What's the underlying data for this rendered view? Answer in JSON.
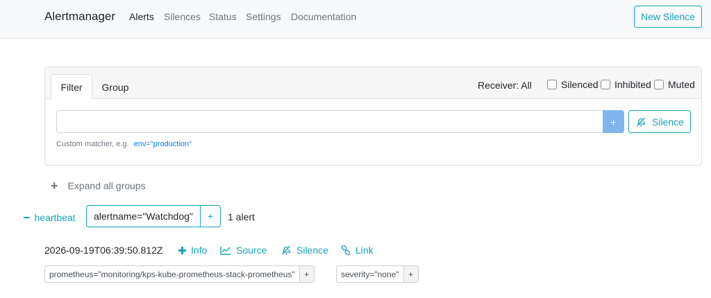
{
  "navbar": {
    "brand": "Alertmanager",
    "links": [
      "Alerts",
      "Silences",
      "Status",
      "Settings",
      "Documentation"
    ],
    "active_link": "Alerts",
    "new_silence": "New Silence"
  },
  "filter_card": {
    "tabs": [
      "Filter",
      "Group"
    ],
    "active_tab": "Filter",
    "receiver": "Receiver: All",
    "checkboxes": [
      {
        "label": "Silenced",
        "checked": false
      },
      {
        "label": "Inhibited",
        "checked": false
      },
      {
        "label": "Muted",
        "checked": false
      }
    ],
    "input_value": "",
    "add_label": "+",
    "silence_label": "Silence",
    "hint_prefix": "Custom matcher, e.g.",
    "hint_example": "env=\"production\""
  },
  "expand_all": {
    "icon": "+",
    "label": "Expand all groups"
  },
  "group": {
    "toggle_icon": "−",
    "name": "heartbeat",
    "label": "alertname=\"Watchdog\"",
    "label_plus": "+",
    "count": "1 alert"
  },
  "alert": {
    "timestamp": "2026-09-19T06:39:50.812Z",
    "actions": {
      "info": "Info",
      "source": "Source",
      "silence": "Silence",
      "link": "Link"
    },
    "labels": [
      {
        "text": "prometheus=\"monitoring/kps-kube-prometheus-stack-prometheus\"",
        "plus": "+"
      },
      {
        "text": "severity=\"none\"",
        "plus": "+"
      }
    ]
  },
  "colors": {
    "accent": "#17a2b8",
    "link_blue": "#007bff",
    "add_button": "#80b5f0",
    "navbar_bg": "#f8f9fa"
  },
  "icons": {
    "info": "plus-icon",
    "source": "chart-line-icon",
    "silence": "bell-slash-icon",
    "link": "link-icon"
  }
}
